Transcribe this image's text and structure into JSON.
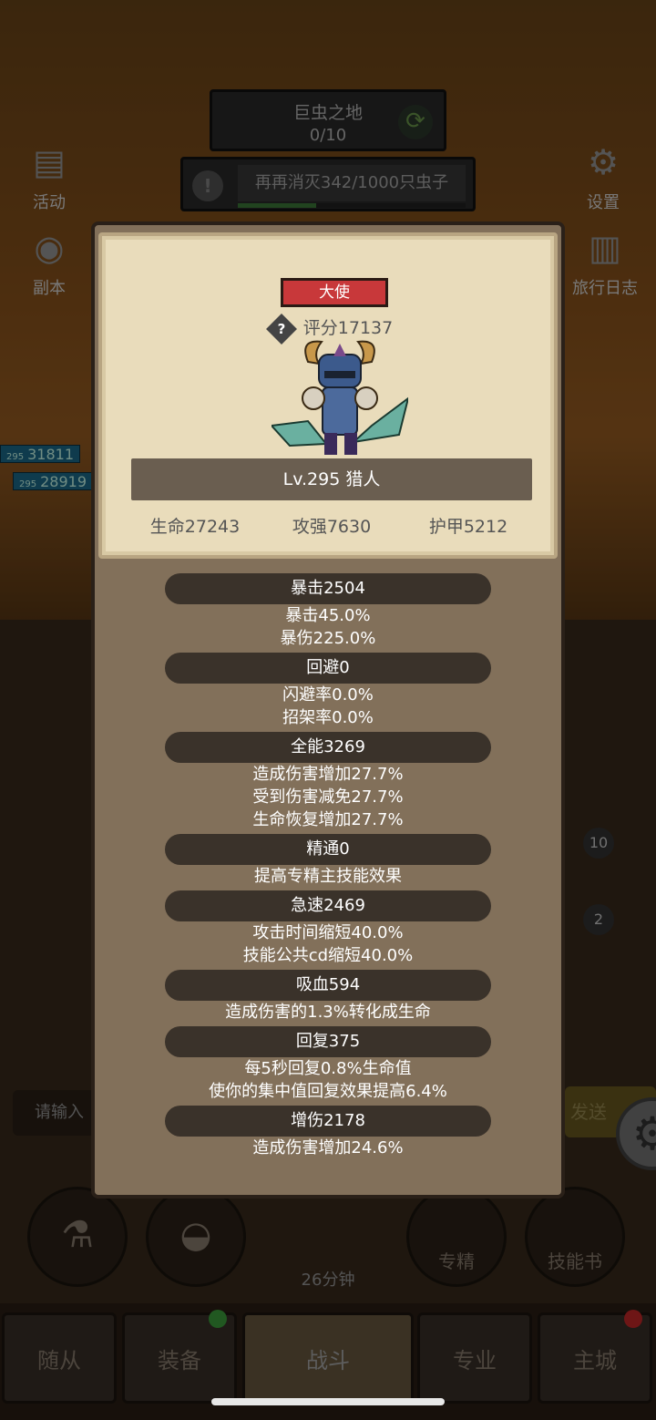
{
  "background": {
    "zone": {
      "name": "巨虫之地",
      "progress": "0/10"
    },
    "quest": {
      "text": "再再消灭342/1000只虫子",
      "progress_fraction": 0.342
    },
    "left_buttons": [
      {
        "label": "活动",
        "icon": "scroll-icon"
      },
      {
        "label": "副本",
        "icon": "portal-icon"
      }
    ],
    "right_buttons": [
      {
        "label": "设置",
        "icon": "gear-icon"
      },
      {
        "label": "旅行日志",
        "icon": "book-icon"
      }
    ],
    "hp_tags": [
      "31811",
      "28919"
    ],
    "hp_levels": [
      "295",
      "295"
    ],
    "input_placeholder": "请输入",
    "send_label": "发送",
    "badges": [
      "10",
      "2"
    ],
    "bottom_round_buttons": [
      {
        "label": "",
        "icon": "potion-icon"
      },
      {
        "label": "",
        "icon": "bread-icon"
      },
      {
        "label": "专精",
        "icon": "specialization-icon"
      },
      {
        "label": "技能书",
        "icon": "skillbook-icon"
      }
    ],
    "timer": "26分钟",
    "tabs": [
      {
        "label": "随从"
      },
      {
        "label": "装备"
      },
      {
        "label": "战斗"
      },
      {
        "label": "专业"
      },
      {
        "label": "主城"
      }
    ]
  },
  "modal": {
    "rank": "大使",
    "score": "评分17137",
    "name": "Lv.295 猎人",
    "base_stats": [
      "生命27243",
      "攻强7630",
      "护甲5212"
    ],
    "stats": [
      {
        "header": "暴击2504",
        "lines": [
          "暴击45.0%",
          "暴伤225.0%"
        ]
      },
      {
        "header": "回避0",
        "lines": [
          "闪避率0.0%",
          "招架率0.0%"
        ]
      },
      {
        "header": "全能3269",
        "lines": [
          "造成伤害增加27.7%",
          "受到伤害减免27.7%",
          "生命恢复增加27.7%"
        ]
      },
      {
        "header": "精通0",
        "lines": [
          "提高专精主技能效果"
        ]
      },
      {
        "header": "急速2469",
        "lines": [
          "攻击时间缩短40.0%",
          "技能公共cd缩短40.0%"
        ]
      },
      {
        "header": "吸血594",
        "lines": [
          "造成伤害的1.3%转化成生命"
        ]
      },
      {
        "header": "回复375",
        "lines": [
          "每5秒回复0.8%生命值",
          "使你的集中值回复效果提高6.4%"
        ]
      },
      {
        "header": "增伤2178",
        "lines": [
          "造成伤害增加24.6%"
        ]
      }
    ]
  },
  "colors": {
    "rank_badge": "#c8383a",
    "card_bg": "#e9dcbb",
    "modal_bg": "#82705a",
    "tab_dot_green": "#3ca03c",
    "tab_dot_red": "#c82828"
  }
}
